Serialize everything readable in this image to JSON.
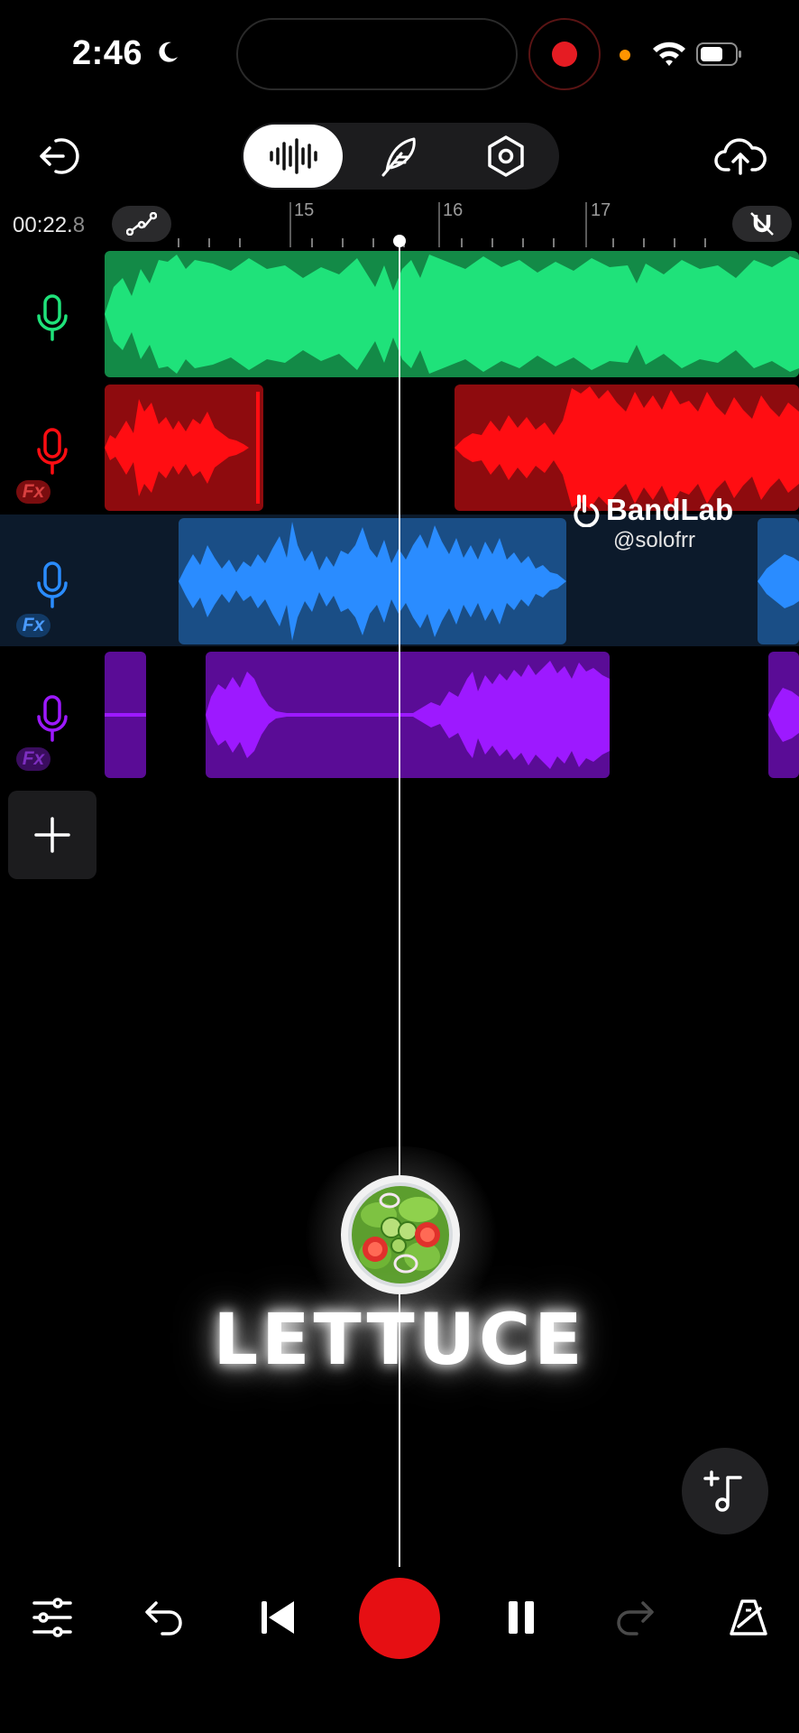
{
  "status_bar": {
    "time": "2:46",
    "icons": [
      "moon-icon",
      "record-indicator",
      "wifi-icon",
      "battery-icon"
    ]
  },
  "top_bar": {
    "modes": [
      "waveform-mode",
      "edit-mode",
      "settings-mode"
    ],
    "active_mode": "waveform-mode"
  },
  "timeline": {
    "time_whole": "00:22.",
    "time_fraction": "8",
    "bar_labels": [
      "15",
      "16",
      "17"
    ]
  },
  "tracks": [
    {
      "name": "track-1",
      "color": "#1fe27a",
      "fx": false
    },
    {
      "name": "track-2",
      "color": "#ff0d12",
      "fx": true,
      "fx_label": "Fx"
    },
    {
      "name": "track-3",
      "color": "#2a8cff",
      "fx": true,
      "fx_label": "Fx",
      "selected": true
    },
    {
      "name": "track-4",
      "color": "#9d19ff",
      "fx": true,
      "fx_label": "Fx"
    }
  ],
  "watermark": {
    "brand": "BandLab",
    "handle": "@solofrr"
  },
  "overlay": {
    "caption": "LETTUCE"
  },
  "transport": {
    "buttons": [
      "mixer",
      "undo",
      "skip-to-start",
      "record",
      "pause",
      "redo",
      "metronome"
    ]
  }
}
